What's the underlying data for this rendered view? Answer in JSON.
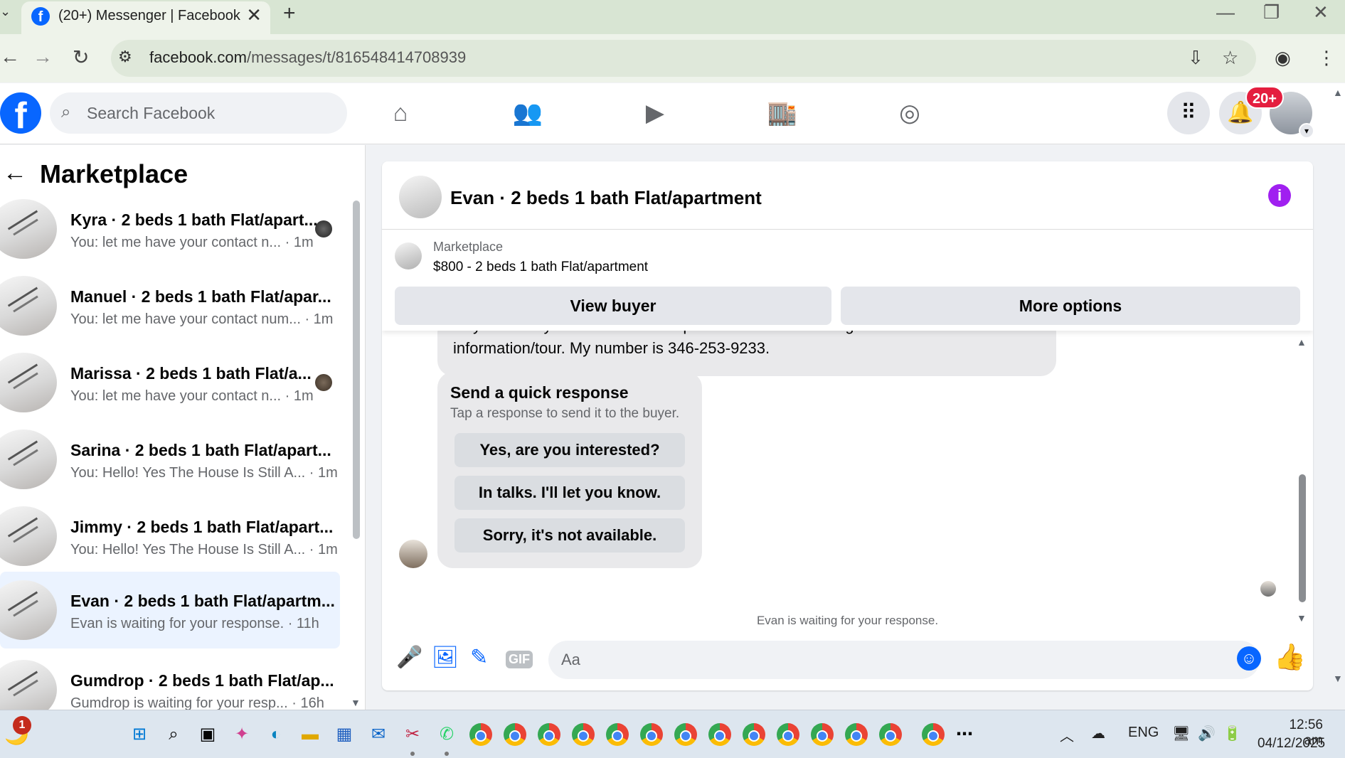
{
  "browser": {
    "tab_title": "(20+) Messenger | Facebook",
    "url_host": "facebook.com",
    "url_path": "/messages/t/816548414708939"
  },
  "header": {
    "search_placeholder": "Search Facebook",
    "notification_badge": "20+"
  },
  "sidebar": {
    "title": "Marketplace",
    "conversations": [
      {
        "name": "Kyra · 2 beds 1 bath Flat/apart...",
        "preview": "You: let me have your contact n... · 1m"
      },
      {
        "name": "Manuel · 2 beds 1 bath Flat/apar...",
        "preview": "You: let me have your contact num... · 1m"
      },
      {
        "name": "Marissa · 2 beds 1 bath Flat/a...",
        "preview": "You: let me have your contact n... · 1m"
      },
      {
        "name": "Sarina · 2 beds 1 bath Flat/apart...",
        "preview": "You: Hello! Yes The House Is Still A... · 1m"
      },
      {
        "name": "Jimmy · 2 beds 1 bath Flat/apart...",
        "preview": "You: Hello! Yes The House Is Still A... · 1m"
      },
      {
        "name": "Evan · 2 beds 1 bath Flat/apartm...",
        "preview": "Evan is waiting for your response. · 11h"
      },
      {
        "name": "Gumdrop · 2 beds 1 bath Flat/ap...",
        "preview": "Gumdrop is waiting for your resp... · 16h"
      }
    ]
  },
  "chat": {
    "title": "Evan · 2 beds 1 bath Flat/apartment",
    "marketplace_label": "Marketplace",
    "listing": "$800 - 2 beds 1 bath Flat/apartment",
    "view_buyer": "View buyer",
    "more_options": "More options",
    "message_cut": "Hey! I'm really interested in this apartment and I'd like to get some additional",
    "message_text": "information/tour. My number is 346-253-9233.",
    "quick_title": "Send a quick response",
    "quick_sub": "Tap a response to send it to the buyer.",
    "quick_replies": [
      "Yes, are you interested?",
      "In talks. I'll let you know.",
      "Sorry, it's not available."
    ],
    "waiting": "Evan is waiting for your response.",
    "composer_placeholder": "Aa",
    "gif_label": "GIF"
  },
  "taskbar": {
    "notif_count": "1",
    "lang": "ENG",
    "time": "12:56 am",
    "date": "04/12/2025"
  }
}
